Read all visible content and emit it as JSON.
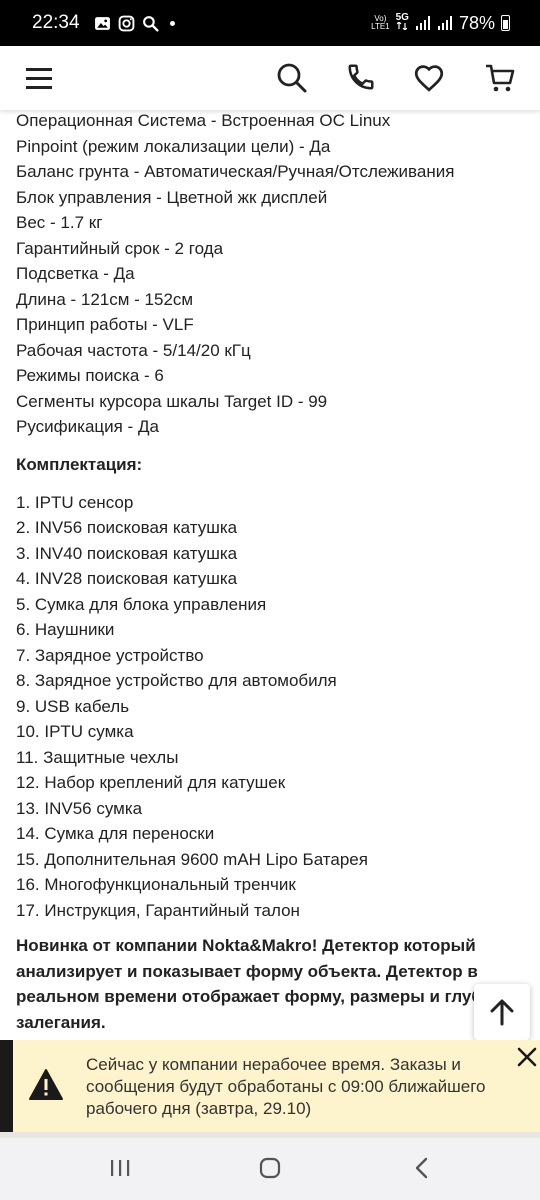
{
  "status_bar": {
    "time": "22:34",
    "network_tag_top": "Vo)",
    "network_tag_bottom": "LTE1",
    "network_type": "5G",
    "battery": "78%"
  },
  "header": {
    "icons": [
      "menu-icon",
      "search-icon",
      "phone-icon",
      "heart-icon",
      "cart-icon"
    ]
  },
  "specs": [
    "Операционная Система  - Встроенная ОС Linux",
    "Pinpoint (режим локализации цели) - Да",
    "Баланс грунта - Автоматическая/Ручная/Отслеживания",
    "Блок управления - Цветной жк дисплей",
    "Вес - 1.7 кг",
    "Гарантийный срок - 2 года",
    "Подсветка - Да",
    "Длина - 121см - 152см",
    "Принцип работы - VLF",
    "Рабочая частота - 5/14/20 кГц",
    "Режимы поиска - 6",
    "Сегменты курсора шкалы Target ID - 99",
    "Русификация - Да"
  ],
  "kit_title": "Комплектация:",
  "kit_items": [
    "1. IPTU сенсор",
    "2. INV56 поисковая катушка",
    "3. INV40 поисковая катушка",
    "4. INV28 поисковая катушка",
    "5. Сумка для блока управления",
    "6. Наушники",
    "7. Зарядное устройство",
    "8. Зарядное устройство для автомобиля",
    "9. USB кабель",
    "10. IPTU сумка",
    "11. Защитные чехлы",
    "12. Набор креплений для катушек",
    "13. INV56 сумка",
    "14. Сумка для переноски",
    "15. Дополнительная 9600 mAH Lipo Батарея",
    "16. Многофункциональный тренчик",
    "17. Инструкция, Гарантийный талон"
  ],
  "promo_text": "Новинка от компании Nokta&Makro! Детектор который анализирует и показывает форму объекта. Детектор в реальном времени отображает форму, размеры и глубину залегания.",
  "notice": {
    "text": "Сейчас у компании нерабочее время. Заказы и сообщения будут обработаны с 09:00 ближайшего рабочего дня (завтра, 29.10)",
    "accent_color": "#1a1a1a",
    "background_color": "#fdf3cc"
  },
  "navbar": {
    "icons": [
      "recent-apps-icon",
      "home-icon",
      "back-icon"
    ]
  }
}
